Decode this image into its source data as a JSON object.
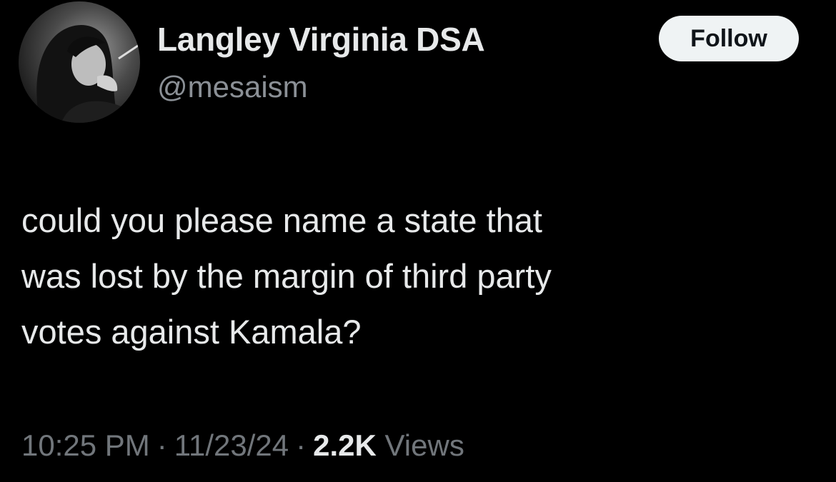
{
  "author": {
    "display_name": "Langley Virginia DSA",
    "handle": "@mesaism"
  },
  "follow_button": {
    "label": "Follow"
  },
  "tweet": {
    "text_lines": [
      "could you please name a state that",
      "was lost by the margin of third party",
      "votes against Kamala?"
    ]
  },
  "meta": {
    "time": "10:25 PM",
    "separator": "·",
    "date": "11/23/24",
    "views_count": "2.2K",
    "views_label": "Views"
  },
  "colors": {
    "background": "#000000",
    "primary_text": "#e7e9ea",
    "secondary_text": "#71767b",
    "follow_button_bg": "#eff3f4"
  }
}
